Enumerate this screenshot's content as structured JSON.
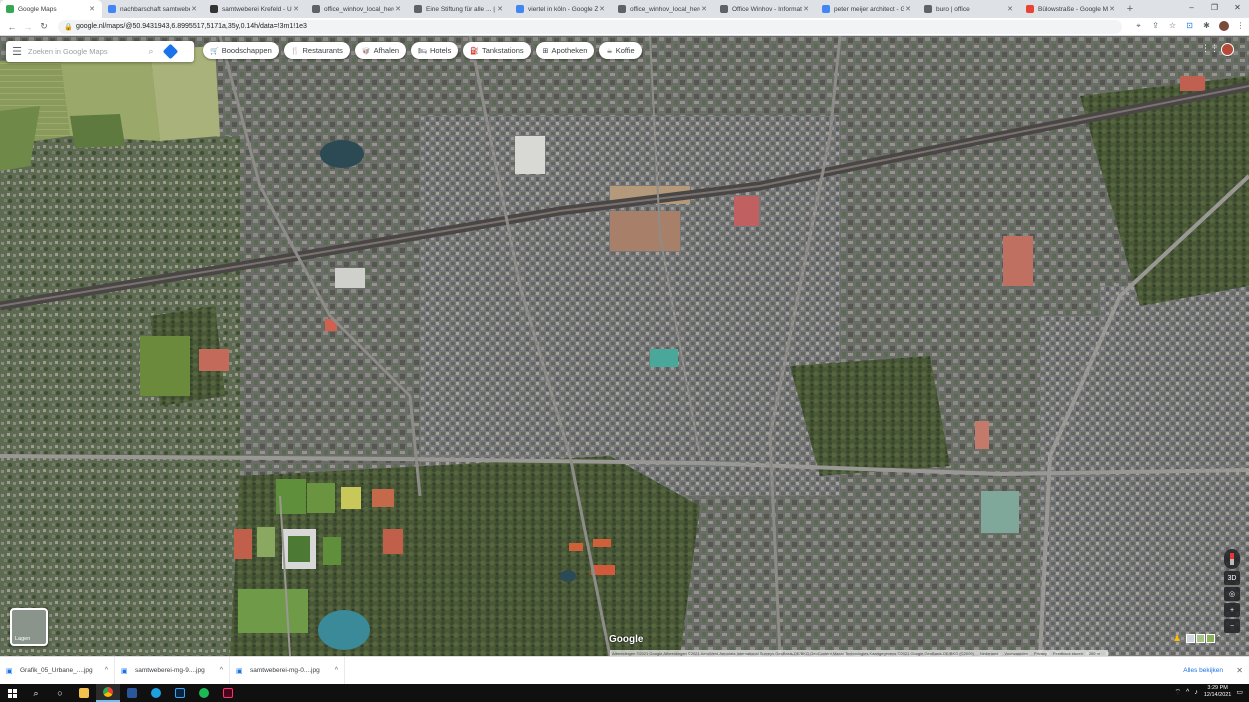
{
  "browser": {
    "tabs": [
      {
        "title": "Google Maps",
        "favicon": "maps-icon",
        "active": true,
        "color": "#34a853"
      },
      {
        "title": "nachbarschaft samtweberei",
        "favicon": "google-icon",
        "active": false,
        "color": "#4285f4"
      },
      {
        "title": "samtweberei Krefeld - Urb",
        "favicon": "museum-icon",
        "active": false,
        "color": "#333333"
      },
      {
        "title": "office_winhov_local_heroe",
        "favicon": "globe-icon",
        "active": false,
        "color": "#5f6368"
      },
      {
        "title": "Eine Stiftung für alle ... | N",
        "favicon": "bookmark-icon",
        "active": false,
        "color": "#5f6368"
      },
      {
        "title": "viertel in köln - Google Zo",
        "favicon": "google-icon",
        "active": false,
        "color": "#4285f4"
      },
      {
        "title": "office_winhov_local_heroe",
        "favicon": "globe-icon",
        "active": false,
        "color": "#5f6368"
      },
      {
        "title": "Office Winhov - Informatie",
        "favicon": "globe-icon",
        "active": false,
        "color": "#5f6368"
      },
      {
        "title": "peter meijer architect - Go",
        "favicon": "google-icon",
        "active": false,
        "color": "#4285f4"
      },
      {
        "title": "buro | office",
        "favicon": "globe-icon",
        "active": false,
        "color": "#5f6368"
      },
      {
        "title": "Bülowstraße - Google Ma",
        "favicon": "maps-icon",
        "active": false,
        "color": "#ea4335"
      }
    ],
    "new_tab": "+",
    "url": "google.nl/maps/@50.9431943,6.8995517,5171a,35y,0.14h/data=!3m1!1e3",
    "window_controls": {
      "minimize": "–",
      "maximize": "❐",
      "close": "✕"
    }
  },
  "maps": {
    "search_placeholder": "Zoeken in Google Maps",
    "chips": [
      {
        "label": "Boodschappen",
        "icon": "cart-icon",
        "glyph": "🛒"
      },
      {
        "label": "Restaurants",
        "icon": "fork-knife-icon",
        "glyph": "🍴"
      },
      {
        "label": "Afhalen",
        "icon": "takeout-icon",
        "glyph": "🥡"
      },
      {
        "label": "Hotels",
        "icon": "bed-icon",
        "glyph": "🛏"
      },
      {
        "label": "Tankstations",
        "icon": "fuel-icon",
        "glyph": "⛽"
      },
      {
        "label": "Apotheken",
        "icon": "pharmacy-icon",
        "glyph": "⊞"
      },
      {
        "label": "Koffie",
        "icon": "coffee-icon",
        "glyph": "☕"
      }
    ],
    "layers_label": "Lagen",
    "google_logo": "Google",
    "controls": {
      "view3d": "3D",
      "zoom_in": "+",
      "zoom_out": "−",
      "locate": "◎",
      "expand": "⌃"
    },
    "attribution": [
      "Afbeeldingen ©2021 Google,Afbeeldingen ©2021 AeroWest,Aerodata International Surveys,GeoBasis-DE/BKG,GeoContent,Maxar Technologies,Kaartgegevens ©2021 Google,GeoBasis-DE/BKG (©2009)",
      "Nederland",
      "Voorwaarden",
      "Privacy",
      "Feedback sturen",
      "200 m"
    ]
  },
  "downloads": {
    "items": [
      {
        "name": "Grafik_05_Urbane_....jpg"
      },
      {
        "name": "samtweberei-mg-9....jpg"
      },
      {
        "name": "samtweberei-mg-0....jpg"
      }
    ],
    "show_all": "Alles bekijken"
  },
  "taskbar": {
    "time": "3:29 PM",
    "date": "12/14/2021"
  }
}
